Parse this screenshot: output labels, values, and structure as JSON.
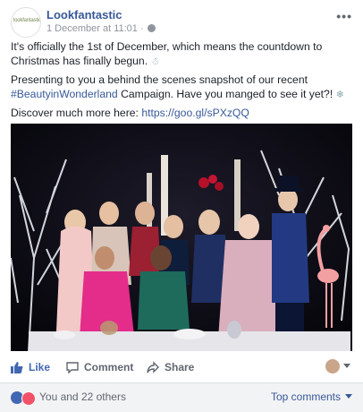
{
  "post": {
    "page_name": "Lookfantastic",
    "avatar_text": "lookfantastic",
    "timestamp": "1 December at 11:01 ·",
    "line1": "It's officially the 1st of December, which means the countdown to Christmas has finally begun.",
    "line2_pre": "Presenting to you a behind the scenes snapshot of our recent ",
    "hashtag": "#BeautyinWonderland",
    "line2_post": " Campaign. Have you manged to see it yet?!",
    "line3_pre": "Discover much more here: ",
    "link": "https://goo.gl/sPXzQQ",
    "more_icon": "more-options-icon"
  },
  "actions": {
    "like": "Like",
    "comment": "Comment",
    "share": "Share"
  },
  "reactions": {
    "summary": "You and 22 others",
    "top_comments": "Top comments"
  },
  "colors": {
    "link_blue": "#385898",
    "like_blue": "#4267b2"
  }
}
